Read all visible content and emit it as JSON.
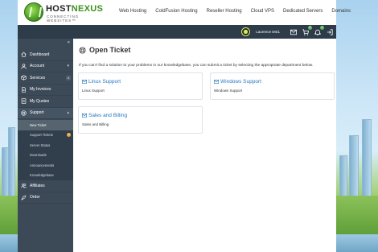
{
  "brand": {
    "name_part1": "HOST",
    "name_part2": "NEXUS",
    "tagline": "CONNECTING WEBSITES™"
  },
  "topnav": [
    "Web Hosting",
    "ColdFusion Hosting",
    "Reseller Hosting",
    "Cloud VPS",
    "Dedicated Servers",
    "Domains"
  ],
  "user": {
    "name": "Laurence test1",
    "cart_count": "0",
    "notifications_count": "0"
  },
  "sidebar": {
    "collapse_icon": "«",
    "items": [
      {
        "label": "Dashboard",
        "icon": "home-icon"
      },
      {
        "label": "Account",
        "icon": "user-icon",
        "has_submenu": true
      },
      {
        "label": "Services",
        "icon": "cube-icon",
        "count": "4"
      },
      {
        "label": "My Invoices",
        "icon": "document-icon"
      },
      {
        "label": "My Quotes",
        "icon": "quote-icon"
      },
      {
        "label": "Support",
        "icon": "lifebuoy-icon",
        "has_submenu": true
      }
    ],
    "support_sub": [
      {
        "label": "New Ticket",
        "active": true
      },
      {
        "label": "Support Tickets",
        "count": "0"
      },
      {
        "label": "Server Status"
      },
      {
        "label": "Downloads"
      },
      {
        "label": "Announcements"
      },
      {
        "label": "Knowledgebase"
      }
    ],
    "items_after": [
      {
        "label": "Affiliates",
        "icon": "group-icon"
      },
      {
        "label": "Order",
        "icon": "rocket-icon"
      }
    ]
  },
  "main": {
    "title": "Open Ticket",
    "intro": "If you can't find a solution to your problems in our knowledgebase, you can submit a ticket by selecting the appropriate department below.",
    "departments": [
      {
        "title": "Linux Support",
        "description": "Linux Support"
      },
      {
        "title": "Windows Support",
        "description": "Windows Support"
      },
      {
        "title": "Sales and Billing",
        "description": "Sales and Billing"
      }
    ]
  },
  "colors": {
    "sidebar_bg": "#3c4a58",
    "header_bar_bg": "#2e3c4a",
    "link_blue": "#2a78bf",
    "brand_green": "#3f8f1e"
  }
}
